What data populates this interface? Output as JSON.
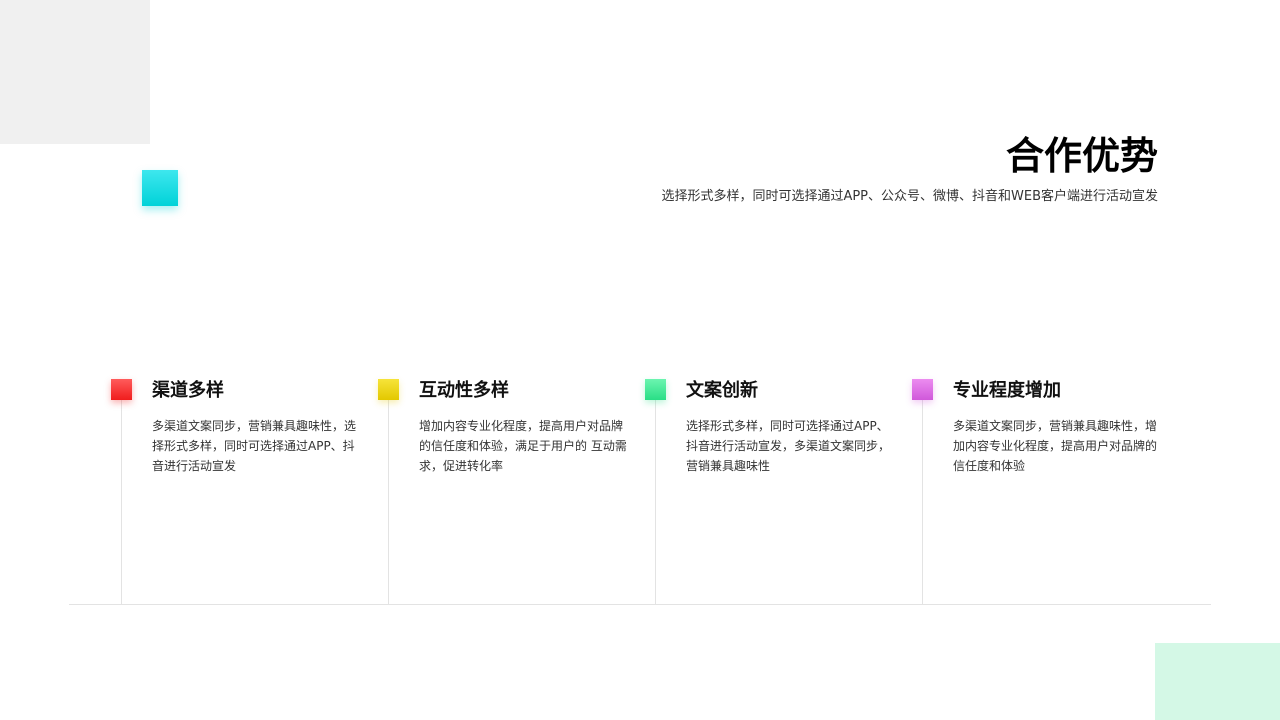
{
  "header": {
    "title": "合作优势",
    "subtitle": "选择形式多样，同时可选择通过APP、公众号、微博、抖音和WEB客户端进行活动宣发"
  },
  "features": [
    {
      "title": "渠道多样",
      "description": "多渠道文案同步，营销兼具趣味性，选择形式多样，同时可选择通过APP、抖音进行活动宣发",
      "color": "#f02a2a"
    },
    {
      "title": "互动性多样",
      "description": "增加内容专业化程度，提高用户对品牌的信任度和体验，满足于用户的 互动需求，促进转化率",
      "color": "#eed41a"
    },
    {
      "title": "文案创新",
      "description": "选择形式多样，同时可选择通过APP、抖音进行活动宣发，多渠道文案同步，营销兼具趣味性",
      "color": "#3de596"
    },
    {
      "title": "专业程度增加",
      "description": "多渠道文案同步，营销兼具趣味性，增加内容专业化程度，提高用户对品牌的信任度和体验",
      "color": "#dc6ee4"
    }
  ],
  "decor": {
    "accent_color": "#00d8de",
    "corner_top_color": "#f0f0f0",
    "corner_bottom_color": "#d4f8e6"
  }
}
